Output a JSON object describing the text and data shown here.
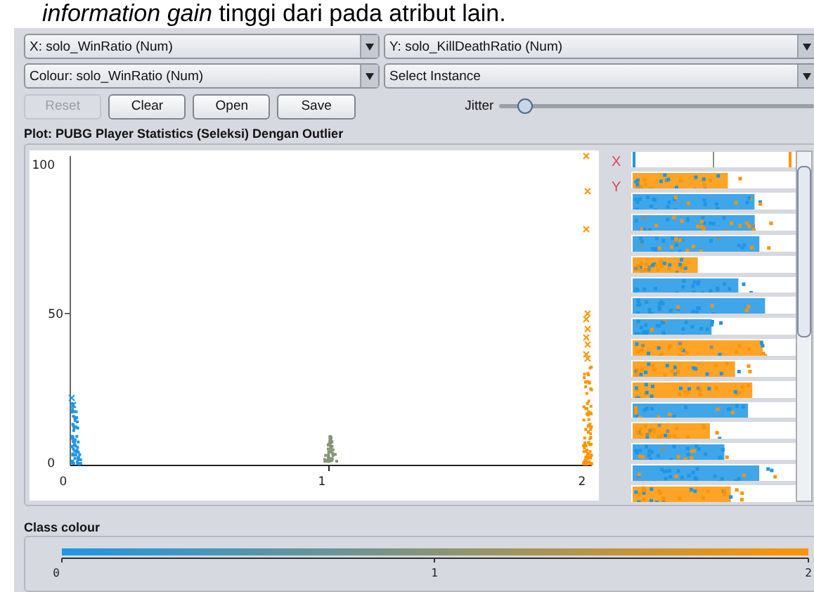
{
  "document_text": "*information gain* tinggi dari pada atribut lain.",
  "selectors": [
    {
      "value": "X: solo_WinRatio (Num)"
    },
    {
      "value": "Y: solo_KillDeathRatio (Num)"
    },
    {
      "value": "Colour: solo_WinRatio (Num)"
    },
    {
      "value": "Select Instance"
    }
  ],
  "buttons": [
    {
      "label": "Reset",
      "disabled": true
    },
    {
      "label": "Clear",
      "disabled": false
    },
    {
      "label": "Open",
      "disabled": false
    },
    {
      "label": "Save",
      "disabled": false
    }
  ],
  "jitter": {
    "label": "Jitter",
    "level": 0.08
  },
  "plot": {
    "title": "Plot: PUBG Player Statistics (Seleksi) Dengan Outlier",
    "y_ticks": [
      "100",
      "50",
      "0"
    ],
    "x_ticks": [
      "0",
      "1",
      "2"
    ]
  },
  "strip_labels": [
    "X",
    "Y"
  ],
  "class_colour": {
    "title": "Class colour",
    "ticks": [
      "0",
      "1",
      "2"
    ]
  }
}
